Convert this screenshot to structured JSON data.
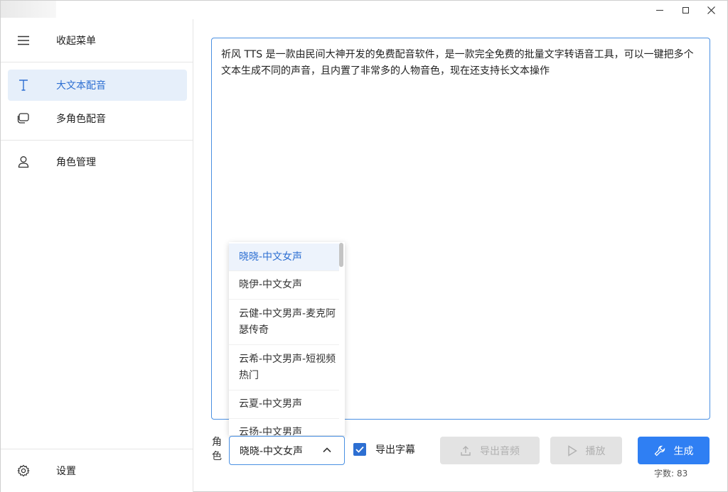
{
  "sidebar": {
    "collapse_label": "收起菜单",
    "items": [
      {
        "label": "大文本配音",
        "icon": "text-icon",
        "active": true
      },
      {
        "label": "多角色配音",
        "icon": "chat-icon"
      },
      {
        "label": "角色管理",
        "icon": "user-icon"
      }
    ],
    "settings_label": "设置"
  },
  "editor": {
    "text": "祈风 TTS 是一款由民间大神开发的免费配音软件，是一款完全免费的批量文字转语音工具，可以一键把多个文本生成不同的声音，且内置了非常多的人物音色，现在还支持长文本操作"
  },
  "role": {
    "label": "角色",
    "selected": "晓晓-中文女声",
    "options": [
      "晓晓-中文女声",
      "晓伊-中文女声",
      "云健-中文男声-麦克阿瑟传奇",
      "云希-中文男声-短视频热门",
      "云夏-中文男声",
      "云扬-中文男声"
    ]
  },
  "subtitle": {
    "label": "导出字幕",
    "checked": true
  },
  "buttons": {
    "export_audio": "导出音频",
    "play": "播放",
    "generate": "生成"
  },
  "count": {
    "label": "字数:",
    "value": "83"
  },
  "colors": {
    "accent": "#2f7ff3",
    "active_bg": "#e6effa"
  }
}
